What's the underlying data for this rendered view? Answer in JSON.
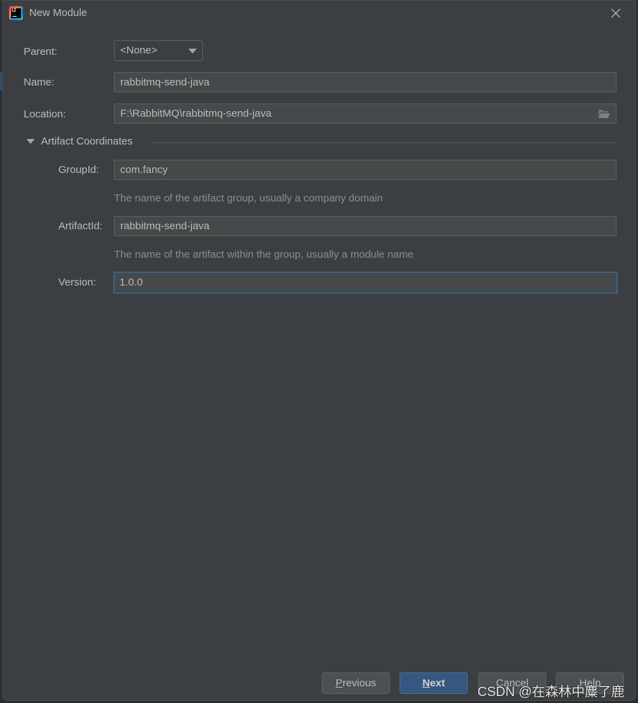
{
  "window": {
    "title": "New Module",
    "app_icon": "intellij-idea-icon",
    "close_icon": "close-icon"
  },
  "form": {
    "parent": {
      "label": "Parent:",
      "value": "<None>"
    },
    "name": {
      "label": "Name:",
      "value": "rabbitmq-send-java"
    },
    "location": {
      "label": "Location:",
      "value": "F:\\RabbitMQ\\rabbitmq-send-java",
      "browse_icon": "folder-open-icon"
    }
  },
  "artifact_section": {
    "title": "Artifact Coordinates",
    "expanded": true,
    "group_id": {
      "label": "GroupId:",
      "value": "com.fancy",
      "hint": "The name of the artifact group, usually a company domain"
    },
    "artifact_id": {
      "label": "ArtifactId:",
      "value": "rabbitmq-send-java",
      "hint": "The name of the artifact within the group, usually a module name"
    },
    "version": {
      "label": "Version:",
      "value": "1.0.0"
    }
  },
  "buttons": {
    "previous": {
      "mnemonic": "P",
      "rest": "revious"
    },
    "next": {
      "mnemonic": "N",
      "rest": "ext"
    },
    "cancel": "Cancel",
    "help": "Help"
  },
  "watermark": "CSDN @在森林中麋了鹿",
  "colors": {
    "background": "#3c3f41",
    "field_bg": "#45494a",
    "focus_border": "#3d6185",
    "primary_button": "#365880"
  }
}
